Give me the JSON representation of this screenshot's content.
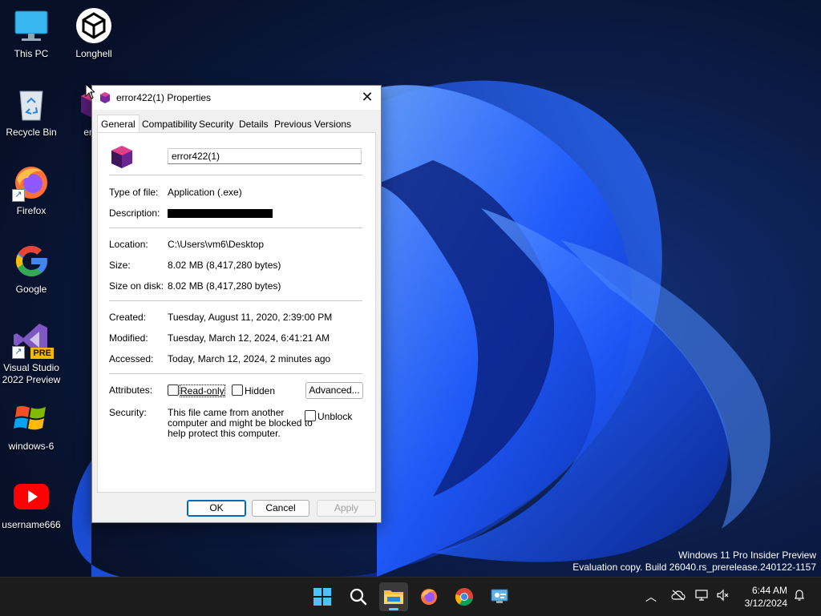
{
  "desktop": {
    "icons": [
      {
        "label": "This PC",
        "icon": "monitor-icon"
      },
      {
        "label": "Longhell",
        "icon": "unity-icon"
      },
      {
        "label": "Recycle Bin",
        "icon": "recycle-bin-icon"
      },
      {
        "label": "error",
        "icon": "app-cube-icon"
      },
      {
        "label": "Firefox",
        "icon": "firefox-icon"
      },
      {
        "label": "Google",
        "icon": "google-icon"
      },
      {
        "label": "Visual Studio 2022 Preview",
        "line1": "Visual Studio",
        "line2": "2022 Preview",
        "badge": "PRE",
        "icon": "visual-studio-icon"
      },
      {
        "label": "windows-6",
        "icon": "windows-logo-icon"
      },
      {
        "label": "username666",
        "icon": "youtube-icon"
      }
    ]
  },
  "watermark": {
    "line1": "Windows 11 Pro Insider Preview",
    "line2": "Evaluation copy. Build 26040.rs_prerelease.240122-1157"
  },
  "dialog": {
    "title": "error422(1) Properties",
    "tabs": [
      "General",
      "Compatibility",
      "Security",
      "Details",
      "Previous Versions"
    ],
    "active_tab": "General",
    "file_name": "error422(1)",
    "rows": {
      "type_label": "Type of file:",
      "type_value": "Application (.exe)",
      "desc_label": "Description:",
      "location_label": "Location:",
      "location_value": "C:\\Users\\vm6\\Desktop",
      "size_label": "Size:",
      "size_value": "8.02 MB (8,417,280 bytes)",
      "size_disk_label": "Size on disk:",
      "size_disk_value": "8.02 MB (8,417,280 bytes)",
      "created_label": "Created:",
      "created_value": "Tuesday, August 11, 2020, 2:39:00 PM",
      "modified_label": "Modified:",
      "modified_value": "Tuesday, March 12, 2024, 6:41:21 AM",
      "accessed_label": "Accessed:",
      "accessed_value": "Today, March 12, 2024, 2 minutes ago"
    },
    "attributes": {
      "label": "Attributes:",
      "readonly": "Read-only",
      "hidden": "Hidden",
      "advanced": "Advanced..."
    },
    "security": {
      "label": "Security:",
      "line1": "This file came from another",
      "line2": "computer and might be blocked to",
      "line3": "help protect this computer.",
      "unblock": "Unblock"
    },
    "buttons": {
      "ok": "OK",
      "cancel": "Cancel",
      "apply": "Apply"
    }
  },
  "taskbar": {
    "items": [
      "start-icon",
      "search-icon",
      "file-explorer-icon",
      "firefox-icon",
      "chrome-icon",
      "control-panel-icon"
    ],
    "active": "file-explorer-icon",
    "clock": {
      "time": "6:44 AM",
      "date": "3/12/2024"
    }
  },
  "colors": {
    "accent": "#0067c0",
    "taskbar": "#1c1c1c",
    "wallpaper": "#1a4fd8"
  }
}
